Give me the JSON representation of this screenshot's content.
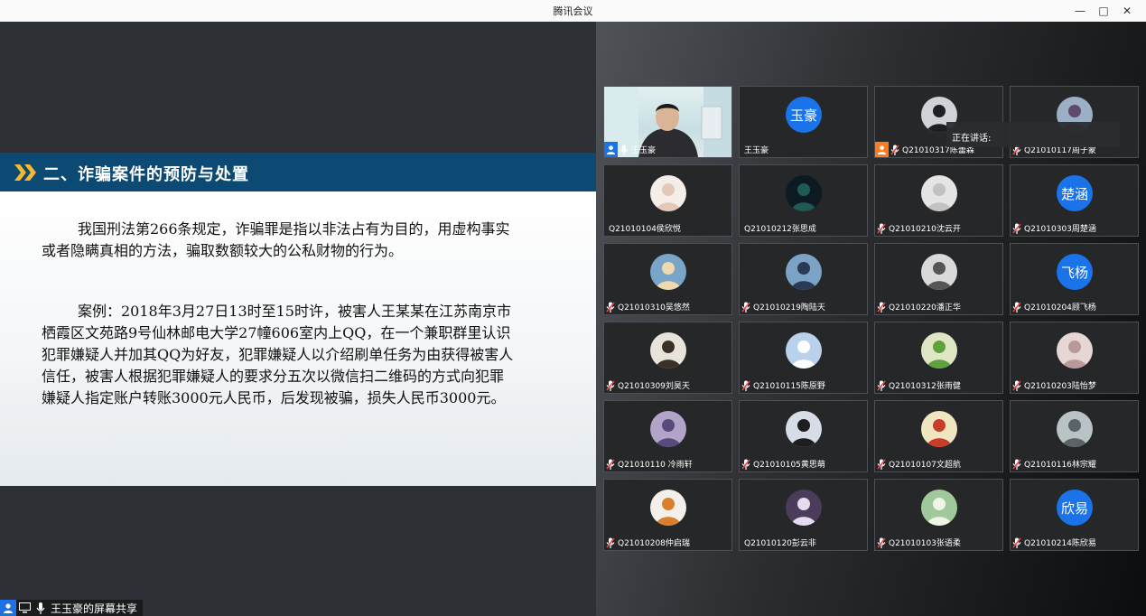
{
  "window": {
    "title": "腾讯会议"
  },
  "slide": {
    "heading": "二、诈骗案件的预防与处置",
    "paragraph1": "我国刑法第266条规定，诈骗罪是指以非法占有为目的，用虚构事实或者隐瞒真相的方法，骗取数额较大的公私财物的行为。",
    "paragraph2": "案例：2018年3月27日13时至15时许，被害人王某某在江苏南京市栖霞区文苑路9号仙林邮电大学27幢606室内上QQ，在一个兼职群里认识犯罪嫌疑人并加其QQ为好友，犯罪嫌疑人以介绍刷单任务为由获得被害人信任，被害人根据犯罪嫌疑人的要求分五次以微信扫二维码的方式向犯罪嫌疑人指定账户转账3000元人民币，后发现被骗，损失人民币3000元。"
  },
  "share_footer": {
    "label": "王玉豪的屏幕共享"
  },
  "speaking_tooltip": {
    "label": "正在讲话:"
  },
  "colors": {
    "accent": "#1a73e8",
    "slide_header": "#0d4a73",
    "host_badge": "#ff7a1a",
    "muted_red": "#e5484d"
  },
  "participants": [
    {
      "name": "王玉豪",
      "kind": "video",
      "mic": "on",
      "badge": "user"
    },
    {
      "name": "王玉豪",
      "kind": "text",
      "initials": "玉豪",
      "mic": "none"
    },
    {
      "name": "Q21010317陈蕾森",
      "kind": "image",
      "bg": "#cfd2d6",
      "fg": "#1e1f22",
      "mic": "muted",
      "badge": "host"
    },
    {
      "name": "Q21010117周子蒙",
      "kind": "image",
      "bg": "#9bb0c4",
      "fg": "#5e4a6a",
      "mic": "muted"
    },
    {
      "name": "Q21010104侯欣悦",
      "kind": "image",
      "bg": "#f4ede8",
      "fg": "#e4c8b8",
      "mic": "none"
    },
    {
      "name": "Q21010212张思成",
      "kind": "image",
      "bg": "#0e1a22",
      "fg": "#1f5a55",
      "mic": "none"
    },
    {
      "name": "Q21010210沈云开",
      "kind": "image",
      "bg": "#e4e4e4",
      "fg": "#c2c2c2",
      "mic": "muted"
    },
    {
      "name": "Q21010303周楚涵",
      "kind": "text",
      "initials": "楚涵",
      "mic": "muted"
    },
    {
      "name": "Q21010310吴悠然",
      "kind": "image",
      "bg": "#79a5c9",
      "fg": "#f0d8b0",
      "mic": "muted"
    },
    {
      "name": "Q21010219陶陆天",
      "kind": "image",
      "bg": "#7aa3c6",
      "fg": "#2a3a55",
      "mic": "muted"
    },
    {
      "name": "Q21010220潘正华",
      "kind": "image",
      "bg": "#d9d9d9",
      "fg": "#555555",
      "mic": "muted"
    },
    {
      "name": "Q21010204顾飞杨",
      "kind": "text",
      "initials": "飞杨",
      "mic": "muted"
    },
    {
      "name": "Q21010309刘昊天",
      "kind": "image",
      "bg": "#e9e4da",
      "fg": "#3a3028",
      "mic": "muted"
    },
    {
      "name": "Q21010115陈原野",
      "kind": "image",
      "bg": "#b9d1ea",
      "fg": "#ffffff",
      "mic": "muted"
    },
    {
      "name": "Q21010312张雨健",
      "kind": "image",
      "bg": "#dfe6c4",
      "fg": "#5fa040",
      "mic": "muted"
    },
    {
      "name": "Q21010203陆怡梦",
      "kind": "image",
      "bg": "#e6d7d4",
      "fg": "#b99a9a",
      "mic": "muted"
    },
    {
      "name": "Q21010110 冷雨轩",
      "kind": "image",
      "bg": "#b2a4c9",
      "fg": "#574b7d",
      "mic": "muted"
    },
    {
      "name": "Q21010105黄思萌",
      "kind": "image",
      "bg": "#d6dde6",
      "fg": "#1e1e1e",
      "mic": "muted"
    },
    {
      "name": "Q21010107文超航",
      "kind": "image",
      "bg": "#f0e6c0",
      "fg": "#c83c2c",
      "mic": "muted"
    },
    {
      "name": "Q21010116林宗耀",
      "kind": "image",
      "bg": "#b9c3c5",
      "fg": "#5a6466",
      "mic": "muted"
    },
    {
      "name": "Q21010208仲启瑞",
      "kind": "image",
      "bg": "#f3f0ec",
      "fg": "#d87e2c",
      "mic": "muted"
    },
    {
      "name": "Q21010120彭云非",
      "kind": "image",
      "bg": "#4a3c5a",
      "fg": "#e6dcf0",
      "mic": "none"
    },
    {
      "name": "Q21010103张语柔",
      "kind": "image",
      "bg": "#9fc99a",
      "fg": "#eef5e6",
      "mic": "muted"
    },
    {
      "name": "Q21010214陈欣易",
      "kind": "text",
      "initials": "欣易",
      "mic": "muted"
    }
  ]
}
